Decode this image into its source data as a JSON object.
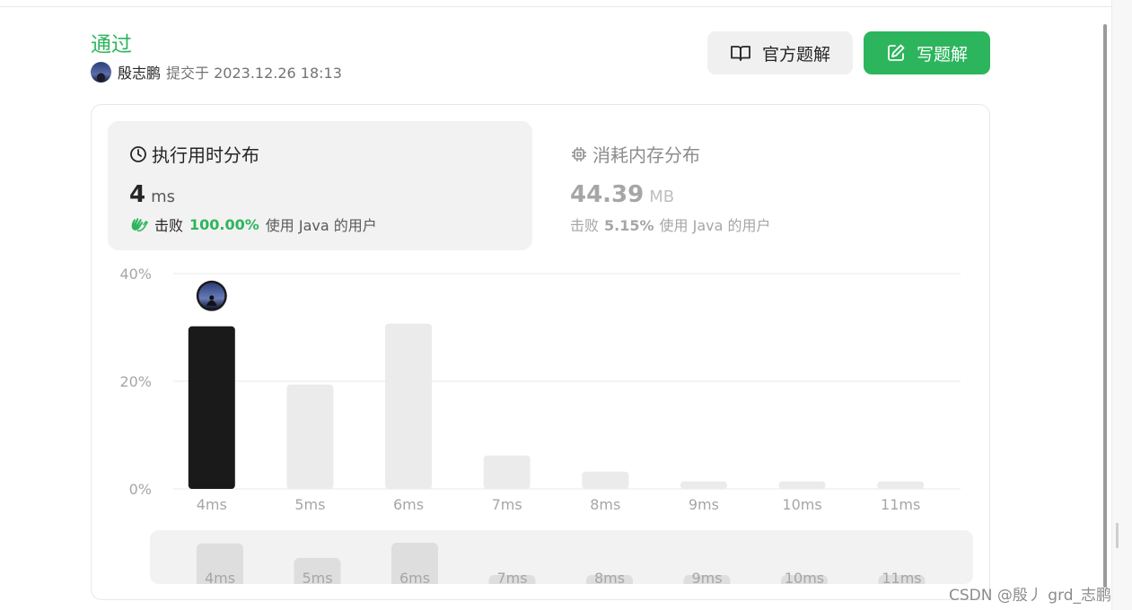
{
  "status": "通过",
  "submission": {
    "author": "殷志鹏",
    "submitted_text": "提交于 2023.12.26 18:13"
  },
  "buttons": {
    "official": "官方题解",
    "write": "写题解"
  },
  "runtime": {
    "title": "执行用时分布",
    "value": "4",
    "unit": "ms",
    "beat_prefix": "击败",
    "beat_percent": "100.00%",
    "beat_suffix": "使用 Java 的用户"
  },
  "memory": {
    "title": "消耗内存分布",
    "value": "44.39",
    "unit": "MB",
    "beat_prefix": "击败",
    "beat_percent": "5.15%",
    "beat_suffix": "使用 Java 的用户"
  },
  "chart_data": {
    "type": "bar",
    "categories": [
      "4ms",
      "5ms",
      "6ms",
      "7ms",
      "8ms",
      "9ms",
      "10ms",
      "11ms"
    ],
    "values": [
      30.2,
      19.4,
      30.7,
      6.2,
      3.2,
      1.4,
      1.4,
      1.4
    ],
    "highlight_index": 0,
    "yticks": [
      "0%",
      "20%",
      "40%"
    ],
    "ylim": [
      0,
      40
    ],
    "colors": {
      "highlight": "#1a1a1a",
      "bar": "#ebebeb",
      "grid": "#e8e8e8"
    },
    "brush": {
      "categories": [
        "4ms",
        "5ms",
        "6ms",
        "7ms",
        "8ms",
        "9ms",
        "10ms",
        "11ms"
      ],
      "values": [
        30.2,
        19.4,
        30.7,
        6.2,
        3.2,
        1.4,
        1.4,
        1.4
      ]
    }
  },
  "watermark": "CSDN @殷丿 grd_志鹏"
}
